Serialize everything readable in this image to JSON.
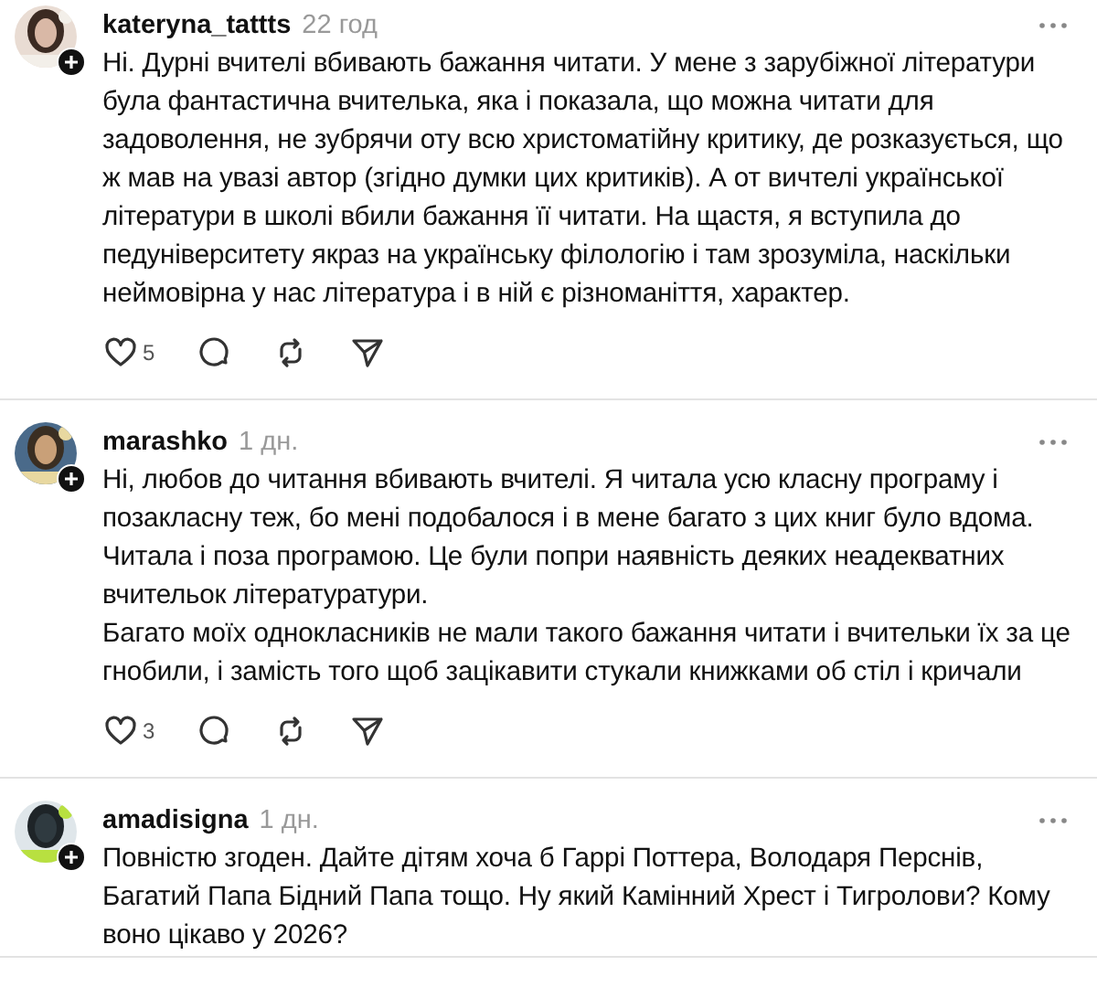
{
  "comments": [
    {
      "username": "kateryna_tattts",
      "time": "22 год",
      "text": "Ні. Дурні вчителі вбивають бажання читати. У мене з зарубіжної літератури була фантастична вчителька, яка і показала, що можна читати для задоволення, не зубрячи оту всю христоматійну критику, де розказується, що ж мав на увазі автор (згідно думки цих критиків). А от вичтелі української літератури в школі вбили бажання її читати. На щастя, я вступила до педуніверситету якраз на українську філологію і там зрозуміла, наскільки неймовірна у нас література і в ній є різноманіття, характер.",
      "likes": "5"
    },
    {
      "username": "marashko",
      "time": "1 дн.",
      "text": "Ні, любов до читання вбивають вчителі. Я читала усю класну програму і позакласну теж, бо мені подобалося і в мене багато з цих книг було вдома. Читала і поза програмою. Це були попри наявність деяких неадекватних вчительок літературатури.\nБагато моїх однокласників не мали такого бажання читати і вчительки їх за це гнобили, і замість того щоб зацікавити стукали книжками об стіл і кричали",
      "likes": "3"
    },
    {
      "username": "amadisigna",
      "time": "1 дн.",
      "text": "Повністю згоден. Дайте дітям хоча б Гаррі Поттера, Володаря Перснів, Багатий Папа Бідний Папа тощо. Ну який Камінний Хрест і Тигролови? Кому воно цікаво у 2026?"
    }
  ]
}
